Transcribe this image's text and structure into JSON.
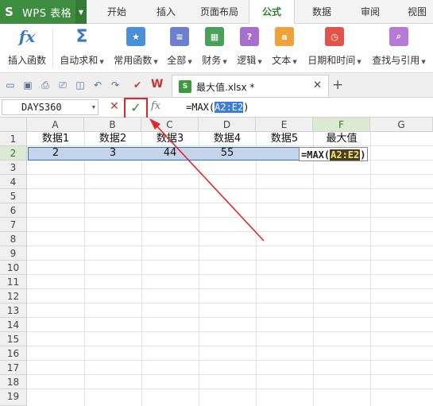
{
  "app": {
    "title": "WPS 表格",
    "logo": "S"
  },
  "menu_tabs": [
    "开始",
    "插入",
    "页面布局",
    "公式",
    "数据",
    "审阅",
    "视图"
  ],
  "active_tab": "公式",
  "ribbon": [
    {
      "label": "插入函数",
      "icon": "fx-icon",
      "color": "#3a78c9",
      "glyph": "fx",
      "caret": false
    },
    {
      "label": "自动求和",
      "icon": "sigma-icon",
      "color": "#3a78c9",
      "glyph": "Σ",
      "caret": true
    },
    {
      "label": "常用函数",
      "icon": "star-book-icon",
      "color": "#4a90d9",
      "glyph": "★",
      "caret": true
    },
    {
      "label": "全部",
      "icon": "book-list-icon",
      "color": "#6f7fd0",
      "glyph": "≡",
      "caret": true
    },
    {
      "label": "财务",
      "icon": "finance-book-icon",
      "color": "#4aa05a",
      "glyph": "▦",
      "caret": true
    },
    {
      "label": "逻辑",
      "icon": "logic-book-icon",
      "color": "#a56fcb",
      "glyph": "?",
      "caret": true
    },
    {
      "label": "文本",
      "icon": "text-book-icon",
      "color": "#f0a23a",
      "glyph": "a",
      "caret": true
    },
    {
      "label": "日期和时间",
      "icon": "clock-book-icon",
      "color": "#e0544b",
      "glyph": "◷",
      "caret": true
    },
    {
      "label": "查找与引用",
      "icon": "search-book-icon",
      "color": "#b77ad6",
      "glyph": "⌕",
      "caret": true
    }
  ],
  "document": {
    "tab_name": "最大值.xlsx *"
  },
  "formula_bar": {
    "name_box": "DAYS360",
    "formula_prefix": "=MAX(",
    "formula_ref": "A2:E2",
    "formula_suffix": ")"
  },
  "columns": [
    "A",
    "B",
    "C",
    "D",
    "E",
    "F",
    "G"
  ],
  "selected_column": "F",
  "rows": [
    "1",
    "2",
    "3",
    "4",
    "5",
    "6",
    "7",
    "8",
    "9",
    "10",
    "11",
    "12",
    "13",
    "14",
    "15",
    "16",
    "17",
    "18",
    "19"
  ],
  "selected_row": "2",
  "sheet": {
    "row1": [
      "数据1",
      "数据2",
      "数据3",
      "数据4",
      "数据5",
      "最大值"
    ],
    "row2": [
      "2",
      "3",
      "44",
      "55",
      ""
    ]
  },
  "edit_cell": {
    "prefix": "=MAX(",
    "ref": "A2:E2",
    "suffix": ")"
  },
  "colors": {
    "brand_green": "#3d8c40",
    "active_tab_text": "#2f7d31",
    "highlight_red": "#e0262b",
    "range_blue": "#2f6fd1"
  }
}
